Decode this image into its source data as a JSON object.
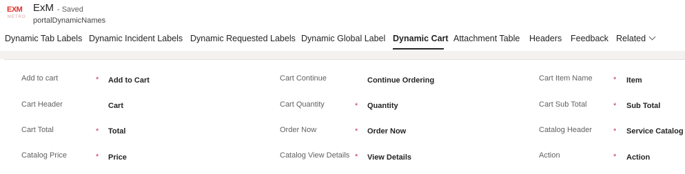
{
  "header": {
    "logo_text": "EXM",
    "logo_subtext": "METRO",
    "app_title": "ExM",
    "save_status": "- Saved",
    "record_name": "portalDynamicNames"
  },
  "tabs": [
    {
      "label": "Dynamic Tab Labels"
    },
    {
      "label": "Dynamic Incident Labels"
    },
    {
      "label": "Dynamic Requested Labels"
    },
    {
      "label": "Dynamic Global Label"
    },
    {
      "label": "Dynamic Cart",
      "active": true
    },
    {
      "label": "Attachment Table"
    },
    {
      "label": "Headers"
    },
    {
      "label": "Feedback"
    },
    {
      "label": "Related"
    }
  ],
  "required_marker": "*",
  "fields": {
    "add_to_cart": {
      "label": "Add to cart",
      "value": "Add to Cart",
      "required": true
    },
    "cart_continue": {
      "label": "Cart Continue",
      "value": "Continue Ordering",
      "required": false
    },
    "cart_item_name": {
      "label": "Cart Item Name",
      "value": "Item",
      "required": true
    },
    "cart_header": {
      "label": "Cart Header",
      "value": "Cart",
      "required": false
    },
    "cart_quantity": {
      "label": "Cart Quantity",
      "value": "Quantity",
      "required": true
    },
    "cart_sub_total": {
      "label": "Cart Sub Total",
      "value": "Sub Total",
      "required": true
    },
    "cart_total": {
      "label": "Cart Total",
      "value": "Total",
      "required": true
    },
    "order_now": {
      "label": "Order Now",
      "value": "Order Now",
      "required": true
    },
    "catalog_header": {
      "label": "Catalog Header",
      "value": "Service Catalog",
      "required": true
    },
    "catalog_price": {
      "label": "Catalog Price",
      "value": "Price",
      "required": true
    },
    "catalog_view_details": {
      "label": "Catalog View Details",
      "value": "View Details",
      "required": true
    },
    "action": {
      "label": "Action",
      "value": "Action",
      "required": true
    }
  },
  "colors": {
    "logo_red": "#e0302a",
    "required_red": "#c4314b",
    "active_tab_underline": "#242424"
  }
}
